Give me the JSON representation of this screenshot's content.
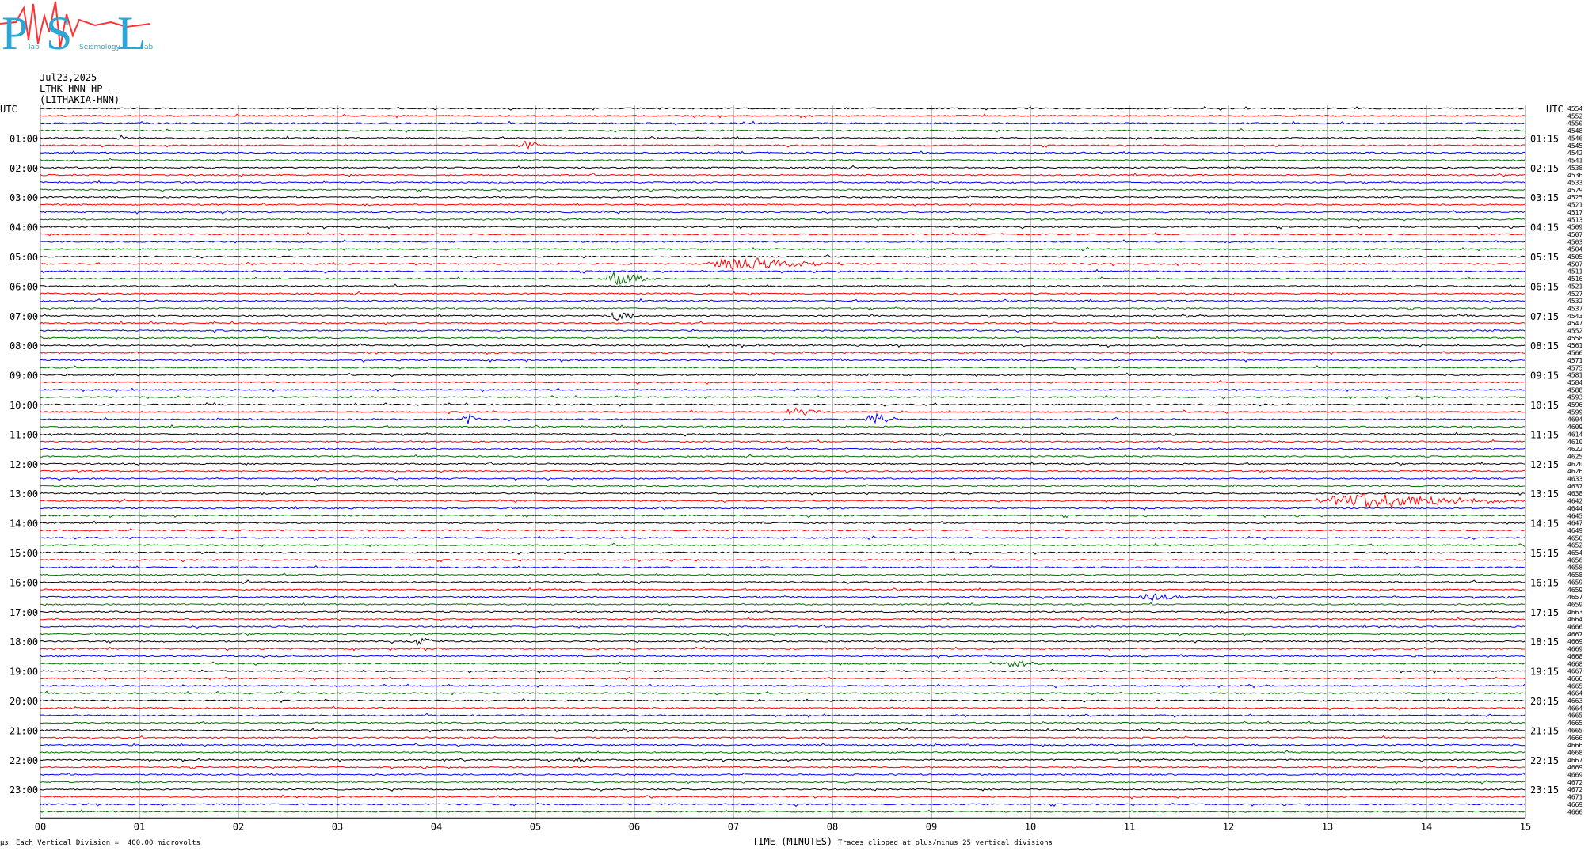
{
  "logo": {
    "letters": [
      "P",
      "S",
      "L"
    ],
    "small": [
      "lab",
      "Seismology",
      "ab"
    ],
    "colors": {
      "text": "#2aa7d6",
      "wave": "#ff3333"
    }
  },
  "header": {
    "date": "Jul23,2025",
    "station": "LTHK HNN HP --",
    "name": "(LITHAKIA-HNN)"
  },
  "footer": {
    "scale": "Each Vertical Division =  400.00 microvolts",
    "corner": "µs",
    "clip": "Traces clipped at plus/minus 25 vertical divisions"
  },
  "chart_data": {
    "type": "seismogram",
    "xlabel": "TIME (MINUTES)",
    "x_ticks": [
      "00",
      "01",
      "02",
      "03",
      "04",
      "05",
      "06",
      "07",
      "08",
      "09",
      "10",
      "11",
      "12",
      "13",
      "14",
      "15"
    ],
    "xlim": [
      0,
      15
    ],
    "left_axis_label": "UTC",
    "right_axis_label": "UTC",
    "left_hours": [
      "01:00",
      "02:00",
      "03:00",
      "04:00",
      "05:00",
      "06:00",
      "07:00",
      "08:00",
      "09:00",
      "10:00",
      "11:00",
      "12:00",
      "13:00",
      "14:00",
      "15:00",
      "16:00",
      "17:00",
      "18:00",
      "19:00",
      "20:00",
      "21:00",
      "22:00",
      "23:00"
    ],
    "right_hours": [
      "01:15",
      "02:15",
      "03:15",
      "04:15",
      "05:15",
      "06:15",
      "07:15",
      "08:15",
      "09:15",
      "10:15",
      "11:15",
      "12:15",
      "13:15",
      "14:15",
      "15:15",
      "16:15",
      "17:15",
      "18:15",
      "19:15",
      "20:15",
      "21:15",
      "22:15",
      "23:15"
    ],
    "trace_colors": [
      "#000000",
      "#ff0000",
      "#0000ff",
      "#007000"
    ],
    "grid": true,
    "traces_per_hour": 4,
    "right_values": [
      "4554",
      "4552",
      "4550",
      "4548",
      "4546",
      "4545",
      "4542",
      "4541",
      "4538",
      "4536",
      "4533",
      "4529",
      "4525",
      "4521",
      "4517",
      "4513",
      "4509",
      "4507",
      "4503",
      "4504",
      "4505",
      "4507",
      "4511",
      "4516",
      "4521",
      "4527",
      "4532",
      "4537",
      "4543",
      "4547",
      "4552",
      "4558",
      "4561",
      "4566",
      "4571",
      "4575",
      "4581",
      "4584",
      "4588",
      "4593",
      "4596",
      "4599",
      "4604",
      "4609",
      "4614",
      "4610",
      "4622",
      "4625",
      "4620",
      "4626",
      "4633",
      "4637",
      "4638",
      "4642",
      "4644",
      "4645",
      "4647",
      "4649",
      "4650",
      "4652",
      "4654",
      "4656",
      "4658",
      "4658",
      "4659",
      "4659",
      "4657",
      "4659",
      "4663",
      "4664",
      "4666",
      "4667",
      "4669",
      "4669",
      "4668",
      "4668",
      "4667",
      "4666",
      "4665",
      "4664",
      "4663",
      "4664",
      "4665",
      "4665",
      "4665",
      "4666",
      "4666",
      "4668",
      "4667",
      "4669",
      "4669",
      "4672",
      "4672",
      "4671",
      "4669",
      "4666"
    ],
    "events": [
      {
        "trace": 4,
        "t": 0.8,
        "amp": 4,
        "dur": 0.15
      },
      {
        "trace": 5,
        "t": 4.9,
        "amp": 7,
        "dur": 0.2
      },
      {
        "trace": 21,
        "t": 7.0,
        "amp": 9,
        "dur": 1.1
      },
      {
        "trace": 23,
        "t": 5.8,
        "amp": 8,
        "dur": 0.5
      },
      {
        "trace": 28,
        "t": 5.8,
        "amp": 6,
        "dur": 0.3
      },
      {
        "trace": 41,
        "t": 7.6,
        "amp": 6,
        "dur": 0.4
      },
      {
        "trace": 42,
        "t": 8.4,
        "amp": 8,
        "dur": 0.3
      },
      {
        "trace": 42,
        "t": 4.3,
        "amp": 7,
        "dur": 0.2
      },
      {
        "trace": 53,
        "t": 13.3,
        "amp": 10,
        "dur": 1.8
      },
      {
        "trace": 66,
        "t": 11.2,
        "amp": 6,
        "dur": 0.4
      },
      {
        "trace": 72,
        "t": 3.8,
        "amp": 5,
        "dur": 0.3
      },
      {
        "trace": 75,
        "t": 9.8,
        "amp": 4,
        "dur": 0.5
      },
      {
        "trace": 88,
        "t": 5.4,
        "amp": 5,
        "dur": 0.2
      }
    ]
  }
}
